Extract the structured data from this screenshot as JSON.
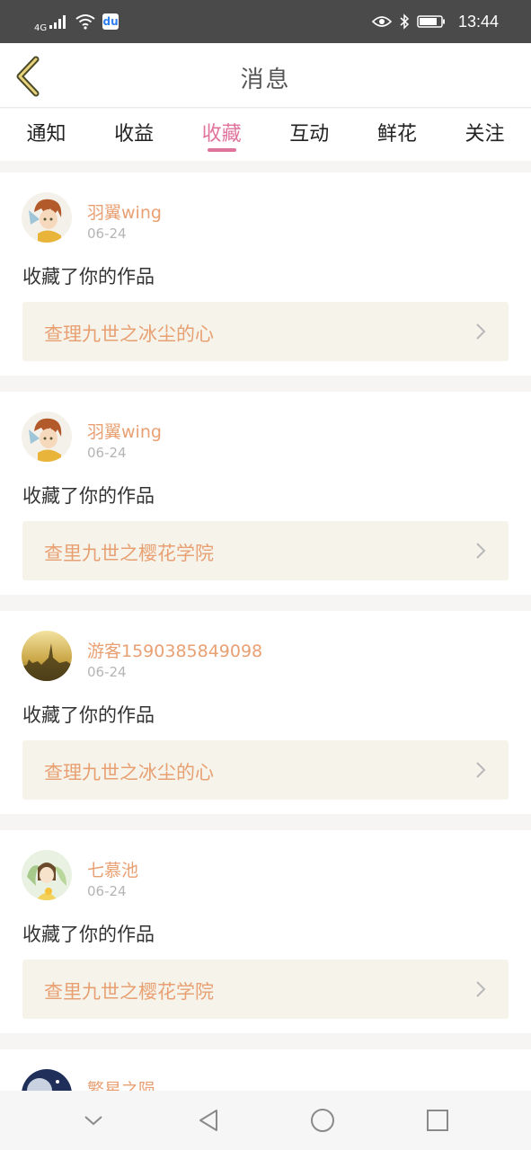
{
  "status_bar": {
    "network": "4G",
    "time": "13:44",
    "app_badge": "du"
  },
  "header": {
    "title": "消息"
  },
  "tabs": [
    {
      "label": "通知",
      "active": false
    },
    {
      "label": "收益",
      "active": false
    },
    {
      "label": "收藏",
      "active": true
    },
    {
      "label": "互动",
      "active": false
    },
    {
      "label": "鲜花",
      "active": false
    },
    {
      "label": "关注",
      "active": false
    }
  ],
  "messages": [
    {
      "username": "羽翼wing",
      "date": "06-24",
      "action": "收藏了你的作品",
      "work": "查理九世之冰尘的心",
      "avatar": "anime-boy-avatar"
    },
    {
      "username": "羽翼wing",
      "date": "06-24",
      "action": "收藏了你的作品",
      "work": "查里九世之樱花学院",
      "avatar": "anime-boy-avatar"
    },
    {
      "username": "游客1590385849098",
      "date": "06-24",
      "action": "收藏了你的作品",
      "work": "查理九世之冰尘的心",
      "avatar": "city-sunset-avatar"
    },
    {
      "username": "七慕池",
      "date": "06-24",
      "action": "收藏了你的作品",
      "work": "查里九世之樱花学院",
      "avatar": "anime-girl-avatar"
    },
    {
      "username": "繁星之陨",
      "avatar": "night-sky-avatar"
    }
  ],
  "colors": {
    "accent_pink": "#e0739c",
    "username_orange": "#e8a073",
    "link_bg": "#f5f3ea",
    "page_bg": "#f7f4f4",
    "status_bar_bg": "#4a4a4a"
  }
}
